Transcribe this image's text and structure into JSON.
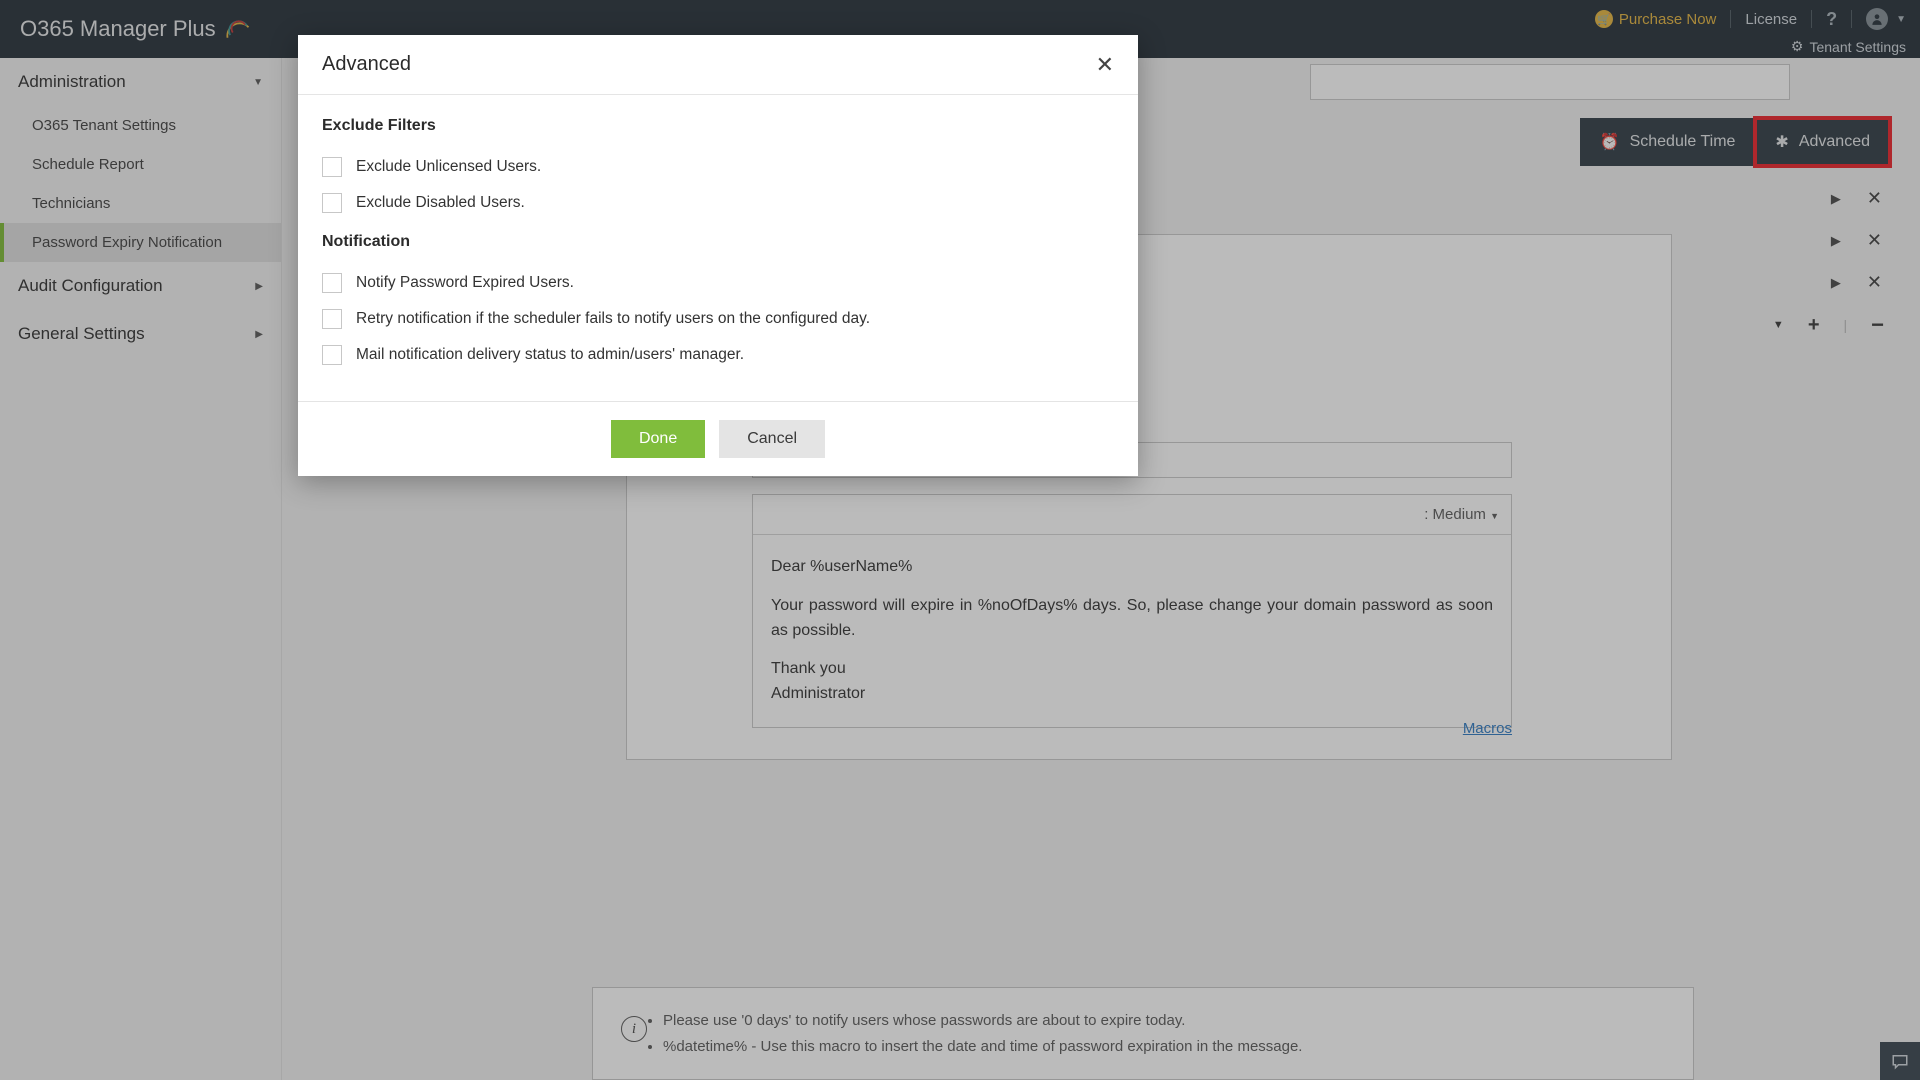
{
  "product_name": "O365 Manager Plus",
  "topbar": {
    "purchase": "Purchase Now",
    "license": "License",
    "tenant_settings": "Tenant Settings"
  },
  "sidebar": {
    "section1": "Administration",
    "items": [
      "O365 Tenant Settings",
      "Schedule Report",
      "Technicians",
      "Password Expiry Notification"
    ],
    "section2": "Audit Configuration",
    "section3": "General Settings"
  },
  "actions": {
    "schedule": "Schedule Time",
    "advanced": "Advanced"
  },
  "editor": {
    "size_label": ": Medium",
    "greeting": "Dear %userName%",
    "body": "Your password will expire in %noOfDays% days. So, please change your domain password as soon as possible.",
    "closing1": "Thank you",
    "closing2": "Administrator",
    "macros": "Macros"
  },
  "hints": [
    "Please use '0 days' to notify users whose passwords are about to expire today.",
    "%datetime% - Use this macro to insert the date and time of password expiration in the message."
  ],
  "modal": {
    "title": "Advanced",
    "section1": "Exclude Filters",
    "opt1": "Exclude Unlicensed Users.",
    "opt2": "Exclude Disabled Users.",
    "section2": "Notification",
    "opt3": "Notify Password Expired Users.",
    "opt4": "Retry notification if the scheduler fails to notify users on the configured day.",
    "opt5": "Mail notification delivery status to admin/users' manager.",
    "done": "Done",
    "cancel": "Cancel"
  }
}
